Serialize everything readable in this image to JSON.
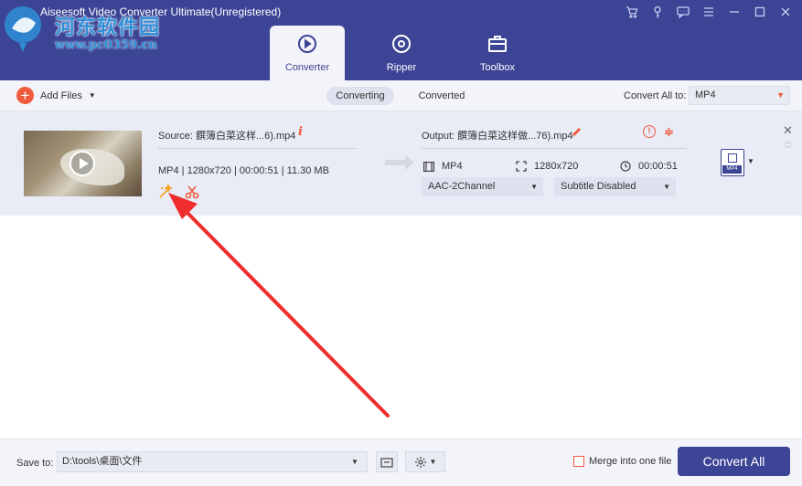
{
  "window": {
    "title": "Aiseesoft Video Converter Ultimate(Unregistered)",
    "watermark_text": "河东软件园",
    "watermark_url": "www.pc0359.cn"
  },
  "nav": {
    "tabs": [
      {
        "label": "Converter",
        "icon": "converter-icon",
        "active": true
      },
      {
        "label": "Ripper",
        "icon": "disc-icon",
        "active": false
      },
      {
        "label": "Toolbox",
        "icon": "toolbox-icon",
        "active": false
      }
    ]
  },
  "toolbar": {
    "add_files_label": "Add Files",
    "tab_converting": "Converting",
    "tab_converted": "Converted",
    "convert_all_to_label": "Convert All to:",
    "convert_all_to_value": "MP4"
  },
  "file": {
    "source_label": "Source: 饌簿白菜这样...6).mp4",
    "source_meta": "MP4 | 1280x720 | 00:00:51 | 11.30 MB",
    "output_label": "Output: 饌簿白菜这样做...76).mp4",
    "output_format": "MP4",
    "output_resolution": "1280x720",
    "output_duration": "00:00:51",
    "audio_track": "AAC-2Channel",
    "subtitle": "Subtitle Disabled",
    "format_badge": "MP4"
  },
  "bottom": {
    "save_to_label": "Save to:",
    "save_path": "D:\\tools\\桌面\\文件",
    "merge_label": "Merge into one file",
    "convert_all_button": "Convert All"
  },
  "colors": {
    "header_bg": "#3c4495",
    "accent": "#ef5a3c",
    "row_bg": "#e9ebf6"
  }
}
